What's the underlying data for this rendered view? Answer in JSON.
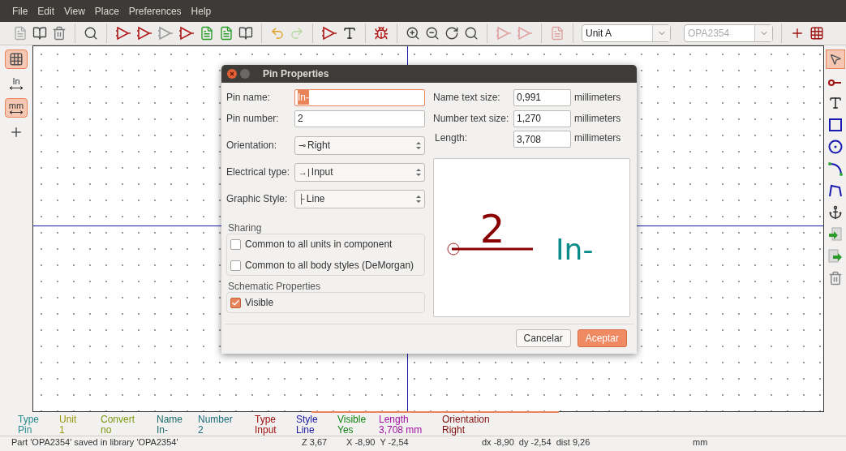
{
  "menu": [
    "File",
    "Edit",
    "View",
    "Place",
    "Preferences",
    "Help"
  ],
  "toolbar": {
    "unit_select": {
      "value": "Unit A",
      "disabled": false
    },
    "part_select": {
      "value": "OPA2354",
      "disabled": true
    }
  },
  "left_toolbar": [
    {
      "kind": "grid",
      "selected": true
    },
    {
      "kind": "units",
      "label": "In",
      "selected": false
    },
    {
      "kind": "units",
      "label": "mm",
      "selected": true
    },
    {
      "kind": "cursor",
      "selected": false
    }
  ],
  "right_toolbar": [
    {
      "kind": "select",
      "selected": true
    },
    {
      "kind": "pin",
      "selected": false
    },
    {
      "kind": "text",
      "selected": false
    },
    {
      "kind": "rect",
      "selected": false
    },
    {
      "kind": "circle",
      "selected": false
    },
    {
      "kind": "arc",
      "selected": false
    },
    {
      "kind": "polyline",
      "selected": false
    },
    {
      "kind": "anchor",
      "selected": false
    },
    {
      "kind": "import",
      "selected": false
    },
    {
      "kind": "export",
      "selected": false
    },
    {
      "kind": "delete",
      "selected": false
    }
  ],
  "dialog": {
    "title": "Pin Properties",
    "pin_name": {
      "label": "Pin name:",
      "value": "In-"
    },
    "pin_number": {
      "label": "Pin number:",
      "value": "2"
    },
    "selects": [
      {
        "label": "Orientation:",
        "symbol": "⊸",
        "value": "Right"
      },
      {
        "label": "Electrical type:",
        "symbol": "→|",
        "value": "Input"
      },
      {
        "label": "Graphic Style:",
        "symbol": "├",
        "value": "Line"
      }
    ],
    "sizes": [
      {
        "label": "Name text size:",
        "value": "0,991",
        "unit": "millimeters"
      },
      {
        "label": "Number text size:",
        "value": "1,270",
        "unit": "millimeters"
      },
      {
        "label": "Length:",
        "value": "3,708",
        "unit": "millimeters"
      }
    ],
    "sharing": {
      "title": "Sharing",
      "options": [
        {
          "label": "Common to all units in component",
          "checked": false
        },
        {
          "label": "Common to all body styles (DeMorgan)",
          "checked": false
        }
      ]
    },
    "schematic": {
      "title": "Schematic Properties",
      "options": [
        {
          "label": "Visible",
          "checked": true
        }
      ]
    },
    "preview": {
      "number": "2",
      "name": "In-"
    },
    "buttons": [
      {
        "label": "Cancelar",
        "primary": false
      },
      {
        "label": "Aceptar",
        "primary": true
      }
    ]
  },
  "message_panel": [
    {
      "label": "Type",
      "value": "Pin",
      "color": "#2a8c8c"
    },
    {
      "label": "Unit",
      "value": "1",
      "color": "#9a9a10"
    },
    {
      "label": "Convert",
      "value": "no",
      "color": "#7a9a10"
    },
    {
      "label": "Name",
      "value": "In-",
      "color": "#1a6a6a"
    },
    {
      "label": "Number",
      "value": "2",
      "color": "#1a6a7a"
    },
    {
      "label": "Type",
      "value": "Input",
      "color": "#a01010"
    },
    {
      "label": "Style",
      "value": "Line",
      "color": "#1a1aa0"
    },
    {
      "label": "Visible",
      "value": "Yes",
      "color": "#108010"
    },
    {
      "label": "Length",
      "value": "3,708 mm",
      "color": "#a010a0"
    },
    {
      "label": "Orientation",
      "value": "Right",
      "color": "#801010"
    }
  ],
  "status_bar": [
    "Part 'OPA2354' saved in library 'OPA2354'",
    "Z 3,67",
    "X -8,90  Y -2,54",
    "dx -8,90  dy -2,54  dist 9,26",
    "mm"
  ]
}
